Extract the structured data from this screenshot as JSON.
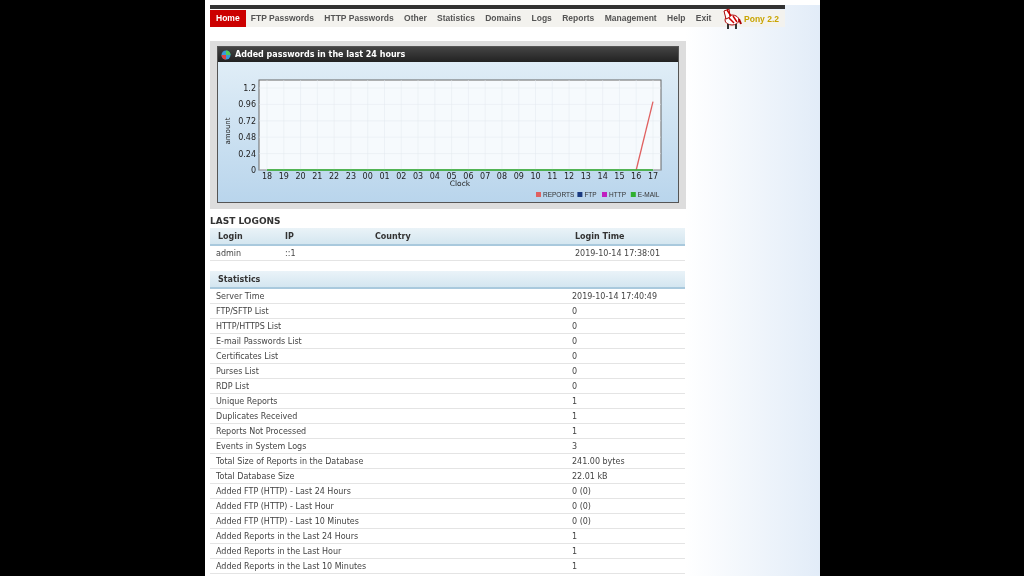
{
  "nav": {
    "items": [
      {
        "label": "Home",
        "selected": true
      },
      {
        "label": "FTP Passwords",
        "selected": false
      },
      {
        "label": "HTTP Passwords",
        "selected": false
      },
      {
        "label": "Other",
        "selected": false
      },
      {
        "label": "Statistics",
        "selected": false
      },
      {
        "label": "Domains",
        "selected": false
      },
      {
        "label": "Logs",
        "selected": false
      },
      {
        "label": "Reports",
        "selected": false
      },
      {
        "label": "Management",
        "selected": false
      },
      {
        "label": "Help",
        "selected": false
      },
      {
        "label": "Exit",
        "selected": false
      }
    ],
    "logo_text": "Pony 2.2"
  },
  "chart_panel": {
    "title": "Added passwords in the last 24 hours",
    "chart_data": {
      "type": "line",
      "xlabel": "Clock",
      "ylabel": "amount",
      "categories": [
        "18",
        "19",
        "20",
        "21",
        "22",
        "23",
        "00",
        "01",
        "02",
        "03",
        "04",
        "05",
        "06",
        "07",
        "08",
        "09",
        "10",
        "11",
        "12",
        "13",
        "14",
        "15",
        "16",
        "17"
      ],
      "grid": true,
      "legend": true,
      "ylim": [
        0,
        1.2
      ],
      "yticks": [
        0,
        {
          "value": 0.24,
          "label": "0.24"
        },
        {
          "value": 0.48,
          "label": "0.48"
        },
        {
          "value": 0.72,
          "label": "0.72"
        },
        {
          "value": 0.96,
          "label": "0.96"
        },
        {
          "value": 1.2,
          "label": "1.2"
        }
      ],
      "series": [
        {
          "name": "REPORTS",
          "color": "#e06060",
          "values": [
            null,
            null,
            null,
            null,
            null,
            null,
            null,
            null,
            null,
            null,
            null,
            null,
            null,
            null,
            null,
            null,
            null,
            null,
            null,
            null,
            null,
            null,
            0,
            1
          ]
        },
        {
          "name": "FTP",
          "color": "#1a3a80",
          "values": [
            null,
            null,
            null,
            null,
            null,
            null,
            null,
            null,
            null,
            null,
            null,
            null,
            null,
            null,
            null,
            null,
            null,
            null,
            null,
            null,
            null,
            null,
            null,
            null
          ]
        },
        {
          "name": "HTTP",
          "color": "#c020c0",
          "values": [
            null,
            null,
            null,
            null,
            null,
            null,
            null,
            null,
            null,
            null,
            null,
            null,
            null,
            null,
            null,
            null,
            null,
            null,
            null,
            null,
            null,
            null,
            null,
            null
          ]
        },
        {
          "name": "E-MAIL",
          "color": "#30b030",
          "values": [
            0,
            0,
            0,
            0,
            0,
            0,
            0,
            0,
            0,
            0,
            0,
            0,
            0,
            0,
            0,
            0,
            0,
            0,
            0,
            0,
            0,
            0,
            0,
            0
          ]
        }
      ]
    }
  },
  "last_logons": {
    "title": "LAST LOGONS",
    "columns": [
      "Login",
      "IP",
      "Country",
      "Login Time"
    ],
    "rows": [
      [
        "admin",
        "::1",
        "",
        "2019-10-14 17:38:01"
      ]
    ]
  },
  "statistics": {
    "title": "Statistics",
    "rows": [
      [
        "Server Time",
        "2019-10-14 17:40:49"
      ],
      [
        "FTP/SFTP List",
        "0"
      ],
      [
        "HTTP/HTTPS List",
        "0"
      ],
      [
        "E-mail Passwords List",
        "0"
      ],
      [
        "Certificates List",
        "0"
      ],
      [
        "Purses List",
        "0"
      ],
      [
        "RDP List",
        "0"
      ],
      [
        "Unique Reports",
        "1"
      ],
      [
        "Duplicates Received",
        "1"
      ],
      [
        "Reports Not Processed",
        "1"
      ],
      [
        "Events in System Logs",
        "3"
      ],
      [
        "Total Size of Reports in the Database",
        "241.00 bytes"
      ],
      [
        "Total Database Size",
        "22.01 kB"
      ],
      [
        "Added FTP (HTTP) - Last 24 Hours",
        "0 (0)"
      ],
      [
        "Added FTP (HTTP) - Last Hour",
        "0 (0)"
      ],
      [
        "Added FTP (HTTP) - Last 10 Minutes",
        "0 (0)"
      ],
      [
        "Added Reports in the Last 24 Hours",
        "1"
      ],
      [
        "Added Reports in the Last Hour",
        "1"
      ],
      [
        "Added Reports in the Last 10 Minutes",
        "1"
      ]
    ]
  }
}
